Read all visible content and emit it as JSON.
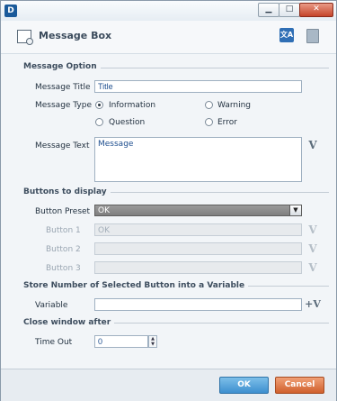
{
  "window": {
    "logo": "D",
    "minimize_glyph": "▁",
    "maximize_glyph": "□",
    "close_glyph": "✕"
  },
  "header": {
    "title": "Message Box",
    "translate_icon_glyph": "文A"
  },
  "message_option": {
    "section_title": "Message Option",
    "title_label": "Message Title",
    "title_value": "Title",
    "type_label": "Message Type",
    "types": [
      {
        "label": "Information",
        "checked": true
      },
      {
        "label": "Warning",
        "checked": false
      },
      {
        "label": "Question",
        "checked": false
      },
      {
        "label": "Error",
        "checked": false
      }
    ],
    "text_label": "Message Text",
    "text_value": "Message",
    "variable_icon_glyph": "V"
  },
  "buttons_to_display": {
    "section_title": "Buttons to display",
    "preset_label": "Button Preset",
    "preset_value": "OK",
    "dropdown_glyph": "▼",
    "buttons": [
      {
        "label": "Button 1",
        "value": "OK"
      },
      {
        "label": "Button 2",
        "value": ""
      },
      {
        "label": "Button 3",
        "value": ""
      }
    ]
  },
  "store_variable": {
    "section_title": "Store Number of Selected Button into a Variable",
    "variable_label": "Variable",
    "variable_value": "",
    "add_variable_glyph": "+V"
  },
  "close_window": {
    "section_title": "Close window after",
    "timeout_label": "Time Out",
    "timeout_value": "0",
    "spin_up": "▲",
    "spin_down": "▼"
  },
  "footer": {
    "ok_label": "OK",
    "cancel_label": "Cancel"
  },
  "colors": {
    "ok": "#3d8fcf",
    "cancel": "#d0602d",
    "section": "#3d4d5e"
  }
}
